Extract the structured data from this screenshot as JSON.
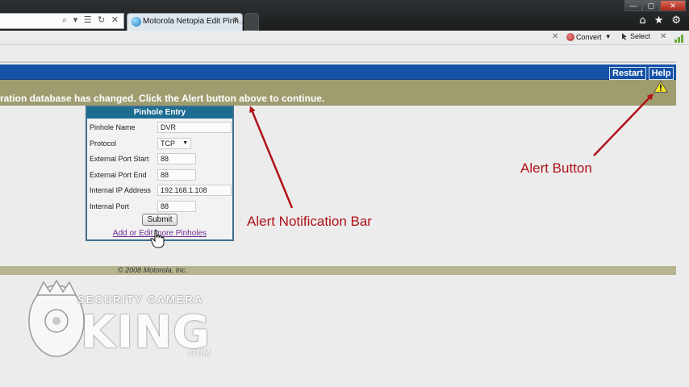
{
  "browser": {
    "tab_title": "Motorola Netopia Edit Pinh...",
    "tab_close": "✕",
    "address_icons": "⌕ ▾ ☰ ↻ ✕",
    "window_controls": {
      "minimize": "—",
      "maximize": "▢",
      "close": "✕"
    },
    "nav_icons": {
      "home": "⌂",
      "favorites": "★",
      "tools": "⚙"
    },
    "toolbar": {
      "close_left": "✕",
      "convert_label": "Convert",
      "convert_caret": "▾",
      "select_label": "Select",
      "close_right": "✕"
    }
  },
  "page": {
    "header": {
      "restart_label": "Restart",
      "help_label": "Help"
    },
    "alert": {
      "message": "ration database has changed. Click the Alert button above to continue.",
      "icon": "warning-icon"
    },
    "form": {
      "title": "Pinhole Entry",
      "fields": [
        {
          "label": "Pinhole Name",
          "value": "DVR"
        },
        {
          "label": "Protocol",
          "value": "TCP"
        },
        {
          "label": "External Port Start",
          "value": "88"
        },
        {
          "label": "External Port End",
          "value": "88"
        },
        {
          "label": "Internal IP Address",
          "value": "192.168.1.108"
        },
        {
          "label": "Internal Port",
          "value": "88"
        }
      ],
      "submit_label": "Submit",
      "more_link": "Add or Edit more Pinholes"
    },
    "footer": "© 2008 Motorola, Inc."
  },
  "annotations": {
    "alert_bar_label": "Alert Notification Bar",
    "alert_button_label": "Alert Button",
    "color": "#b01218"
  },
  "watermark": {
    "line1": "SECURITY CAMERA",
    "line2": "KING",
    "line3": ".COM"
  }
}
